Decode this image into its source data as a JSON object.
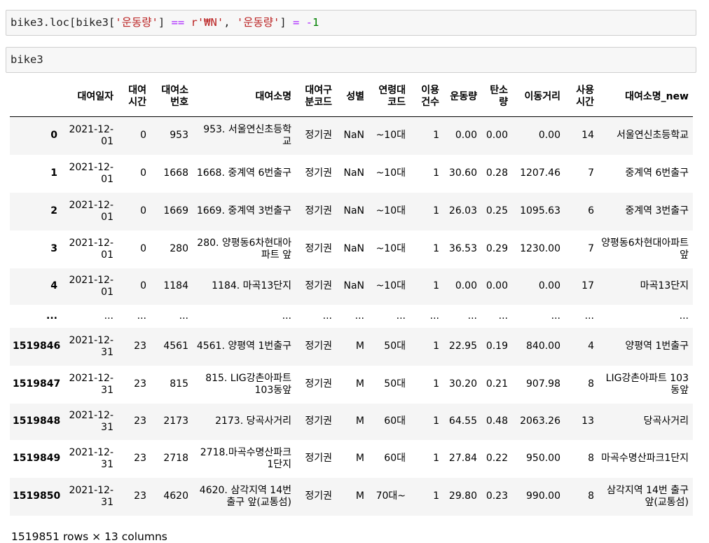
{
  "cells": [
    {
      "tokens": [
        {
          "text": "bike3",
          "kind": "name"
        },
        {
          "text": ".",
          "kind": "punc"
        },
        {
          "text": "loc",
          "kind": "name"
        },
        {
          "text": "[",
          "kind": "punc"
        },
        {
          "text": "bike3",
          "kind": "name"
        },
        {
          "text": "[",
          "kind": "punc"
        },
        {
          "text": "'운동량'",
          "kind": "str"
        },
        {
          "text": "] ",
          "kind": "punc"
        },
        {
          "text": "==",
          "kind": "op"
        },
        {
          "text": " ",
          "kind": "punc"
        },
        {
          "text": "r'₩N'",
          "kind": "str"
        },
        {
          "text": ", ",
          "kind": "punc"
        },
        {
          "text": "'운동량'",
          "kind": "str"
        },
        {
          "text": "] ",
          "kind": "punc"
        },
        {
          "text": "=",
          "kind": "op"
        },
        {
          "text": " ",
          "kind": "punc"
        },
        {
          "text": "-",
          "kind": "op"
        },
        {
          "text": "1",
          "kind": "num"
        }
      ]
    },
    {
      "tokens": [
        {
          "text": "bike3",
          "kind": "name"
        }
      ]
    }
  ],
  "table": {
    "columns": [
      "",
      "대여일자",
      "대여시간",
      "대여소번호",
      "대여소명",
      "대여구분코드",
      "성별",
      "연령대코드",
      "이용건수",
      "운동량",
      "탄소량",
      "이동거리",
      "사용시간",
      "대여소명_new"
    ],
    "rows": [
      {
        "index": "0",
        "cells": [
          "2021-12-01",
          "0",
          "953",
          "953. 서울연신초등학교",
          "정기권",
          "NaN",
          "~10대",
          "1",
          "0.00",
          "0.00",
          "0.00",
          "14",
          "서울연신초등학교"
        ]
      },
      {
        "index": "1",
        "cells": [
          "2021-12-01",
          "0",
          "1668",
          "1668. 중계역 6번출구",
          "정기권",
          "NaN",
          "~10대",
          "1",
          "30.60",
          "0.28",
          "1207.46",
          "7",
          "중계역 6번출구"
        ]
      },
      {
        "index": "2",
        "cells": [
          "2021-12-01",
          "0",
          "1669",
          "1669. 중계역 3번출구",
          "정기권",
          "NaN",
          "~10대",
          "1",
          "26.03",
          "0.25",
          "1095.63",
          "6",
          "중계역 3번출구"
        ]
      },
      {
        "index": "3",
        "cells": [
          "2021-12-01",
          "0",
          "280",
          "280. 양평동6차현대아파트 앞",
          "정기권",
          "NaN",
          "~10대",
          "1",
          "36.53",
          "0.29",
          "1230.00",
          "7",
          "양평동6차현대아파트 앞"
        ]
      },
      {
        "index": "4",
        "cells": [
          "2021-12-01",
          "0",
          "1184",
          "1184. 마곡13단지",
          "정기권",
          "NaN",
          "~10대",
          "1",
          "0.00",
          "0.00",
          "0.00",
          "17",
          "마곡13단지"
        ]
      },
      {
        "index": "...",
        "cells": [
          "...",
          "...",
          "...",
          "...",
          "...",
          "...",
          "...",
          "...",
          "...",
          "...",
          "...",
          "...",
          "..."
        ]
      },
      {
        "index": "1519846",
        "cells": [
          "2021-12-31",
          "23",
          "4561",
          "4561. 양평역 1번출구",
          "정기권",
          "M",
          "50대",
          "1",
          "22.95",
          "0.19",
          "840.00",
          "4",
          "양평역 1번출구"
        ]
      },
      {
        "index": "1519847",
        "cells": [
          "2021-12-31",
          "23",
          "815",
          "815. LIG강촌아파트 103동앞",
          "정기권",
          "M",
          "50대",
          "1",
          "30.20",
          "0.21",
          "907.98",
          "8",
          "LIG강촌아파트 103동앞"
        ]
      },
      {
        "index": "1519848",
        "cells": [
          "2021-12-31",
          "23",
          "2173",
          "2173. 당곡사거리",
          "정기권",
          "M",
          "60대",
          "1",
          "64.55",
          "0.48",
          "2063.26",
          "13",
          "당곡사거리"
        ]
      },
      {
        "index": "1519849",
        "cells": [
          "2021-12-31",
          "23",
          "2718",
          "2718.마곡수명산파크1단지",
          "정기권",
          "M",
          "60대",
          "1",
          "27.84",
          "0.22",
          "950.00",
          "8",
          "마곡수명산파크1단지"
        ]
      },
      {
        "index": "1519850",
        "cells": [
          "2021-12-31",
          "23",
          "4620",
          "4620. 삼각지역 14번 출구 앞(교통섬)",
          "정기권",
          "M",
          "70대~",
          "1",
          "29.80",
          "0.23",
          "990.00",
          "8",
          "삼각지역 14번 출구 앞(교통섬)"
        ]
      }
    ]
  },
  "footer": "1519851 rows × 13 columns"
}
